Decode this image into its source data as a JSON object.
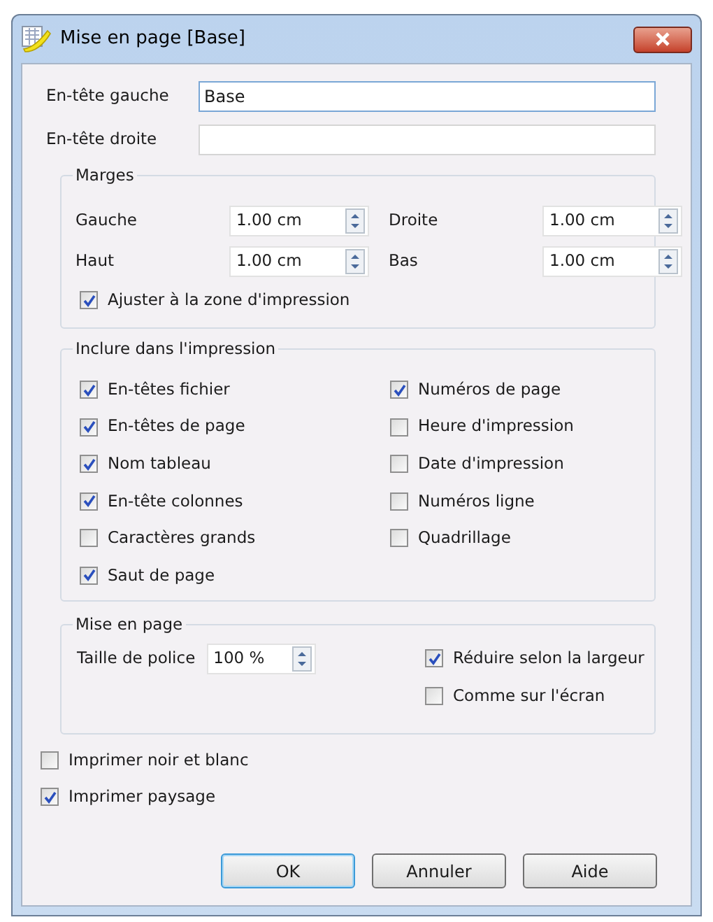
{
  "window": {
    "title": "Mise en page [Base]"
  },
  "header_fields": [
    {
      "label": "En-tête gauche",
      "value": "Base",
      "focused": true
    },
    {
      "label": "En-tête droite",
      "focused": false
    }
  ],
  "margins": {
    "title": "Marges",
    "fields": [
      {
        "label": "Gauche",
        "value": "1.00 cm"
      },
      {
        "label": "Droite",
        "value": "1.00 cm"
      },
      {
        "label": "Haut",
        "value": "1.00 cm"
      },
      {
        "label": "Bas",
        "value": "1.00 cm"
      }
    ],
    "fit_checkbox": {
      "label": "Ajuster à la zone d'impression",
      "checked": true
    }
  },
  "include": {
    "title": "Inclure dans l'impression",
    "left": [
      {
        "label": "En-têtes fichier",
        "checked": true
      },
      {
        "label": "En-têtes de page",
        "checked": true
      },
      {
        "label": "Nom tableau",
        "checked": true
      },
      {
        "label": "En-tête colonnes",
        "checked": true
      },
      {
        "label": "Caractères grands",
        "checked": false
      },
      {
        "label": "Saut de page",
        "checked": true
      }
    ],
    "right": [
      {
        "label": "Numéros de page",
        "checked": true
      },
      {
        "label": "Heure d'impression",
        "checked": false
      },
      {
        "label": "Date d'impression",
        "checked": false
      },
      {
        "label": "Numéros ligne",
        "checked": false
      },
      {
        "label": "Quadrillage",
        "checked": false
      }
    ]
  },
  "layout": {
    "title": "Mise en page",
    "font_size": {
      "label": "Taille de police",
      "value": "100 %"
    },
    "options": [
      {
        "label": "Réduire selon la largeur",
        "checked": true
      },
      {
        "label": "Comme sur l'écran",
        "checked": false
      }
    ]
  },
  "bottom_options": [
    {
      "label": "Imprimer noir et blanc",
      "checked": false
    },
    {
      "label": "Imprimer paysage",
      "checked": true
    }
  ],
  "buttons": [
    {
      "label": "OK",
      "default": true
    },
    {
      "label": "Annuler",
      "default": false
    },
    {
      "label": "Aide",
      "default": false
    }
  ]
}
